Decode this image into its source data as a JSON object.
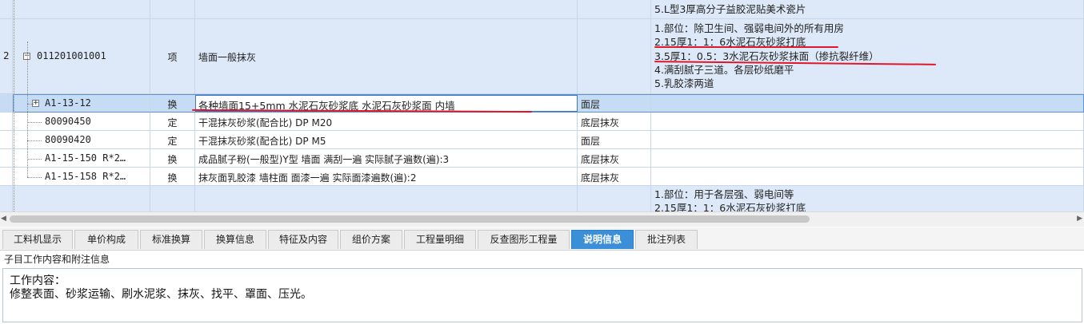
{
  "grid": {
    "rows": [
      {
        "kind": "features-tail",
        "features": [
          "5.L型3厚高分子益胶泥贴美术瓷片"
        ]
      },
      {
        "kind": "item",
        "index": "2",
        "code": "011201001001",
        "type": "项",
        "name": "墙面一般抹灰",
        "unit": "",
        "features": [
          "1.部位：除卫生间、强弱电间外的所有用房",
          "2.15厚1：1：6水泥石灰砂浆打底",
          "3.5厚1：0.5：3水泥石灰砂浆抹面（掺抗裂纤维）",
          "4.满刮腻子三道。各层砂纸磨平",
          "5.乳胶漆两道"
        ]
      },
      {
        "kind": "sub",
        "selected": true,
        "code": "A1-13-12",
        "type": "换",
        "name": "各种墙面15+5mm 水泥石灰砂浆底 水泥石灰砂浆面 内墙",
        "unit": "面层"
      },
      {
        "kind": "mat",
        "code": "80090450",
        "type": "定",
        "name": "干混抹灰砂浆(配合比) DP M20",
        "unit": "底层抹灰"
      },
      {
        "kind": "mat",
        "code": "80090420",
        "type": "定",
        "name": "干混抹灰砂浆(配合比) DP M5",
        "unit": "面层"
      },
      {
        "kind": "sub",
        "code": "A1-15-150 R*2…",
        "type": "换",
        "name": "成品腻子粉(一般型)Y型 墙面 满刮一遍  实际腻子遍数(遍):3",
        "unit": "底层抹灰"
      },
      {
        "kind": "sub",
        "code": "A1-15-158 R*2…",
        "type": "换",
        "name": "抹灰面乳胶漆 墙柱面 面漆一遍  实际面漆遍数(遍):2",
        "unit": "底层抹灰"
      },
      {
        "kind": "item-next",
        "features": [
          "1.部位：用于各层强、弱电间等",
          "2.15厚1：1：6水泥石灰砂浆打底"
        ]
      }
    ],
    "expand_minus": "−",
    "expand_plus": "+"
  },
  "scrollbar": {
    "left_arrow": "◀",
    "right_arrow": "▶"
  },
  "tabs": [
    "工料机显示",
    "单价构成",
    "标准换算",
    "换算信息",
    "特征及内容",
    "组价方案",
    "工程量明细",
    "反查图形工程量",
    "说明信息",
    "批注列表"
  ],
  "active_tab": "说明信息",
  "panel": {
    "title": "子目工作内容和附注信息",
    "lines": [
      "工作内容：",
      "修整表面、砂浆运输、刷水泥浆、抹灰、找平、罩面、压光。"
    ]
  },
  "colors": {
    "accent": "#3b8fd9",
    "row_blue": "#dde9f8",
    "annotation_red": "#e0162b"
  }
}
